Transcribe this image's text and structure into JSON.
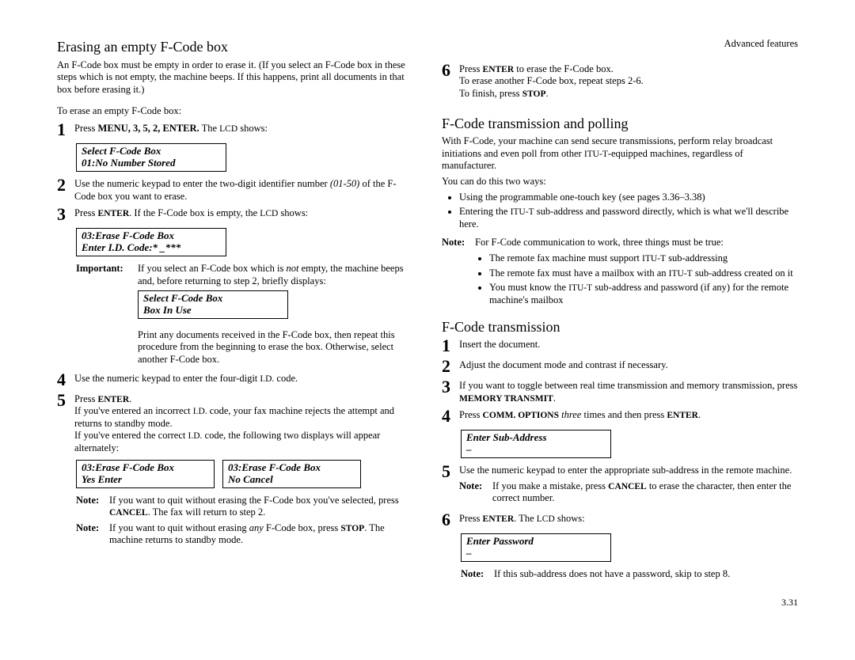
{
  "header": {
    "section": "Advanced features"
  },
  "left": {
    "h1": "Erasing an empty F-Code box",
    "intro": "An F-Code box must be empty in order to erase it. (If you select an F-Code box in these steps which is not empty, the machine beeps. If this happens, print all documents in that box before erasing it.)",
    "lead": "To erase an empty F-Code box:",
    "s1a": "Press ",
    "s1b": "MENU, 3, 5, 2, ENTER.",
    "s1c": " The ",
    "s1d": "LCD",
    "s1e": " shows:",
    "lcd1a": "Select F-Code Box",
    "lcd1b": "01:No Number Stored",
    "s2a": "Use the numeric keypad to enter the two-digit identifier number ",
    "s2b": "(01-50)",
    "s2c": " of the F-Code box you want to erase.",
    "s3a": "Press ",
    "s3b": "ENTER",
    "s3c": ". If the F-Code box is empty, the ",
    "s3d": "LCD",
    "s3e": " shows:",
    "lcd2a": "03:Erase F-Code Box",
    "lcd2b": "Enter I.D. Code:*   _***",
    "impLabel": "Important:",
    "imp1": "If you select an F-Code box which is ",
    "imp2": "not",
    "imp3": " empty, the machine beeps and, before returning to step 2, briefly displays:",
    "lcd3a": "Select F-Code Box",
    "lcd3b": "Box In Use",
    "impAfter": "Print any documents received in the F-Code box, then repeat this procedure from the beginning to erase the box. Otherwise, select another F-Code box.",
    "s4a": "Use the numeric keypad to enter the four-digit ",
    "s4b": "I.D.",
    "s4c": " code.",
    "s5a": "Press ",
    "s5b": "ENTER",
    "s5c": ".",
    "s5d": "If you've entered an incorrect ",
    "s5e": "I.D.",
    "s5f": " code, your fax machine rejects the attempt and returns to standby mode.",
    "s5g": "If you've entered the correct ",
    "s5h": "I.D.",
    "s5i": " code, the following two displays will appear alternately:",
    "lcd4a": "03:Erase F-Code Box",
    "lcd4b": "Yes       Enter",
    "lcd5a": "03:Erase F-Code Box",
    "lcd5b": "No        Cancel",
    "noteLabel": "Note:",
    "n1a": "If you want to quit without erasing the F-Code box you've selected, press ",
    "n1b": "CANCEL",
    "n1c": ". The fax will return to step 2.",
    "n2a": "If you want to quit without erasing ",
    "n2b": "any",
    "n2c": " F-Code box, press ",
    "n2d": "STOP",
    "n2e": ". The machine returns to standby mode."
  },
  "right": {
    "s6a": "Press ",
    "s6b": "ENTER",
    "s6c": " to erase the F-Code box.",
    "s6d": "To erase another F-Code box, repeat steps 2-6.",
    "s6e": "To finish, press ",
    "s6f": "STOP",
    "s6g": ".",
    "h2": "F-Code transmission and polling",
    "p1a": "With F-Code, your machine can send secure transmissions, perform relay broadcast initiations and even poll from other ",
    "p1b": "ITU-T",
    "p1c": "-equipped machines, regardless of manufacturer.",
    "p2": "You can do this two ways:",
    "b1": "Using the programmable one-touch key (see pages 3.36–3.38)",
    "b2a": "Entering the ",
    "b2b": "ITU-T",
    "b2c": " sub-address and password directly, which is what we'll describe here.",
    "noteLabel": "Note:",
    "n1": "For F-Code communication to work, three things must be true:",
    "sb1a": "The remote fax machine must support ",
    "sb1b": "ITU-T",
    "sb1c": " sub-addressing",
    "sb2a": "The remote fax must have a mailbox with an ",
    "sb2b": "ITU-T",
    "sb2c": " sub-address created on it",
    "sb3a": "You must know the ",
    "sb3b": "ITU-T",
    "sb3c": " sub-address and password (if any) for the remote machine's mailbox",
    "h3": "F-Code transmission",
    "t1": "Insert the document.",
    "t2": "Adjust the document mode and contrast if necessary.",
    "t3a": "If you want to toggle between real time transmission and memory transmission, press ",
    "t3b": "MEMORY TRANSMIT",
    "t3c": ".",
    "t4a": "Press ",
    "t4b": "COMM. OPTIONS",
    "t4c": " three",
    "t4d": " times and then press ",
    "t4e": "ENTER",
    "t4f": ".",
    "lcd6a": "Enter Sub-Address",
    "lcd6b": "–",
    "t5": "Use the numeric keypad to enter the appropriate sub-address in the remote machine.",
    "t5nLabel": "Note:",
    "t5n1": "If you make a mistake, press ",
    "t5n2": "CANCEL",
    "t5n3": " to erase the character, then enter the correct number.",
    "t6a": "Press ",
    "t6b": "ENTER",
    "t6c": ". The ",
    "t6d": "LCD",
    "t6e": " shows:",
    "lcd7a": "Enter Password",
    "lcd7b": "–",
    "t6nLabel": "Note:",
    "t6n": "If this sub-address does not have a password, skip to step 8."
  },
  "pagenum": "3.31"
}
